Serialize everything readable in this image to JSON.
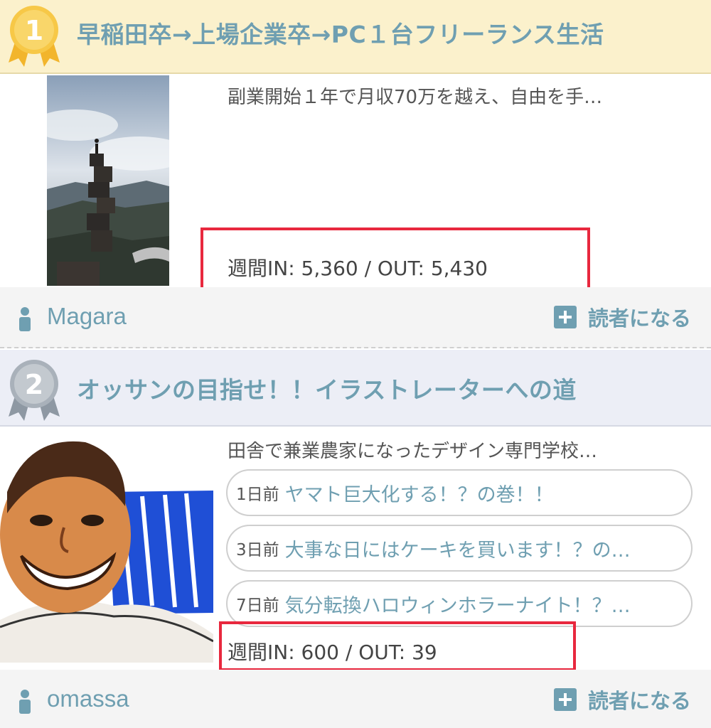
{
  "entries": [
    {
      "rank": "1",
      "title": "早稲田卒→上場企業卒→PC１台フリーランス生活",
      "description": "副業開始１年で月収70万を越え、自由を手…",
      "stats": "週間IN: 5,360  / OUT: 5,430",
      "user": "Magara",
      "follow_label": "読者になる",
      "medal_color": "#f2b52c"
    },
    {
      "rank": "2",
      "title": "オッサンの目指せ！！イラストレーターへの道",
      "description": "田舎で兼業農家になったデザイン専門学校…",
      "recent_posts": [
        {
          "date": "1日前",
          "title": "ヤマト巨大化する！？の巻！！"
        },
        {
          "date": "3日前",
          "title": "大事な日にはケーキを買います！？の…"
        },
        {
          "date": "7日前",
          "title": "気分転換ハロウィンホラーナイト！？…"
        }
      ],
      "stats": "週間IN: 600  / OUT: 39",
      "user": "omassa",
      "follow_label": "読者になる",
      "medal_color": "#9aa3ad"
    }
  ],
  "colors": {
    "accent": "#6f9fb1",
    "highlight": "#e8283e",
    "gold_bar": "#fbf1cc",
    "silver_bar": "#eceef6"
  }
}
